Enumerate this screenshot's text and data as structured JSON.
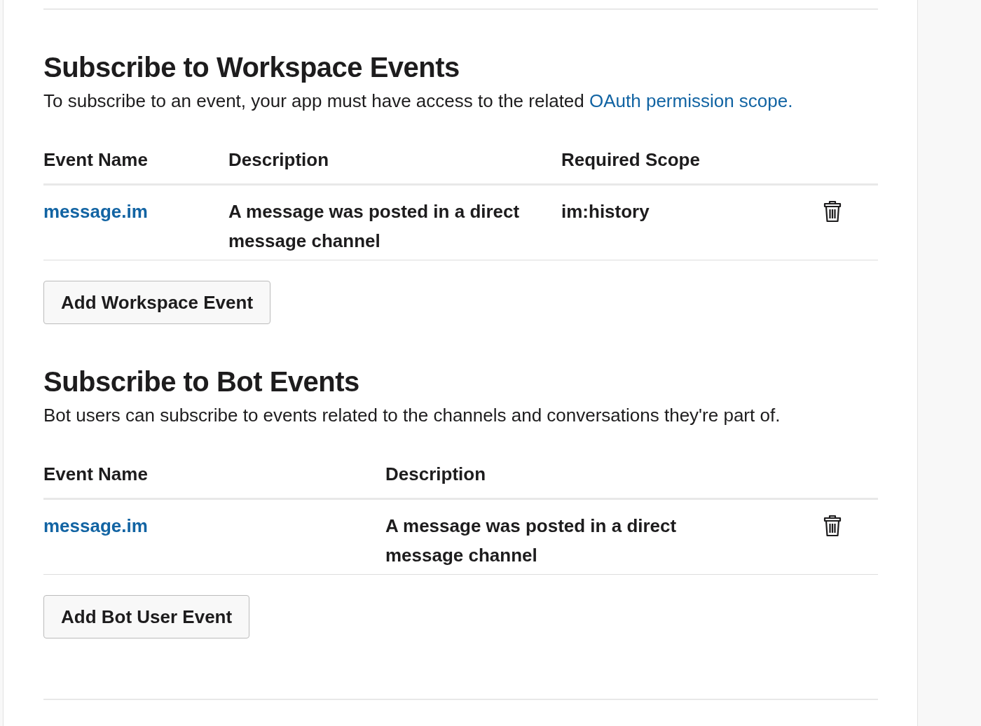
{
  "sections": [
    {
      "title": "Subscribe to Workspace Events",
      "description": "To subscribe to an event, your app must have access to the related ",
      "link": "OAuth permission scope.",
      "columns": [
        "Event Name",
        "Description",
        "Required Scope"
      ],
      "rows": [
        {
          "cells": [
            "message.im",
            "A message was posted in a direct message channel",
            "im:history"
          ]
        }
      ],
      "button": "Add Workspace Event"
    },
    {
      "title": "Subscribe to Bot Events",
      "description": "Bot users can subscribe to events related to the channels and conversations they're part of.",
      "columns": [
        "Event Name",
        "Description"
      ],
      "rows": [
        {
          "cells": [
            "message.im",
            "A message was posted in a direct message channel"
          ]
        }
      ],
      "button": "Add Bot User Event"
    }
  ]
}
